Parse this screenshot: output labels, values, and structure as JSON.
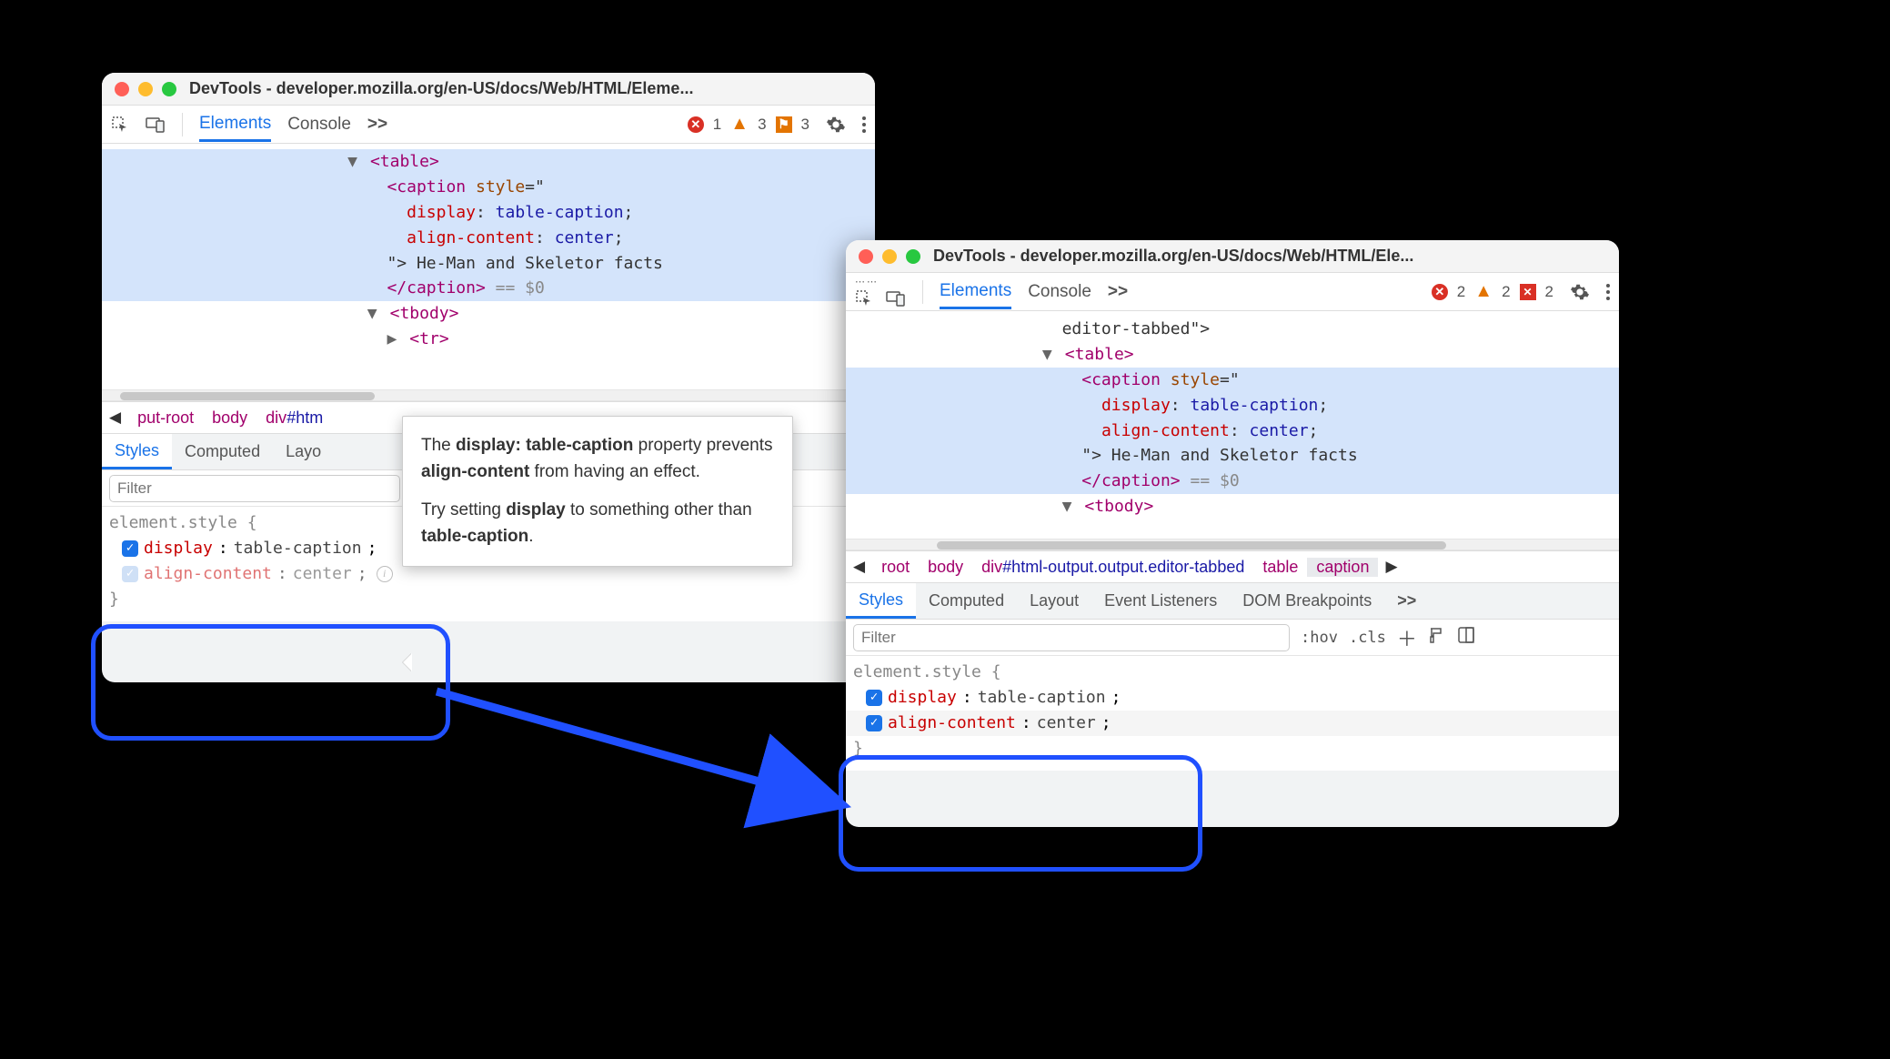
{
  "window1": {
    "title": "DevTools - developer.mozilla.org/en-US/docs/Web/HTML/Eleme...",
    "tabs": {
      "elements": "Elements",
      "console": "Console",
      "more": ">>"
    },
    "status": {
      "errors": "1",
      "warnings": "3",
      "flags": "3"
    },
    "dom": {
      "table_open": "<table>",
      "caption_open": "<caption",
      "style_attr": "style",
      "style_eq": "=\"",
      "css_display_prop": "display",
      "css_display_val": "table-caption",
      "css_align_prop": "align-content",
      "css_align_val": "center",
      "style_close": "\">",
      "caption_text": " He-Man and Skeletor facts",
      "caption_close": "</caption>",
      "eq_dollar": " == $0",
      "tbody_open": "<tbody>",
      "tr_open": "<tr>"
    },
    "breadcrumb": {
      "item0": "put-root",
      "item1": "body",
      "item2": "div",
      "item2_suffix": "#htm"
    },
    "subtabs": {
      "styles": "Styles",
      "computed": "Computed",
      "layout": "Layo"
    },
    "filter_placeholder": "Filter",
    "styles": {
      "selector": "element.style {",
      "p1_name": "display",
      "p1_value": "table-caption",
      "p2_name": "align-content",
      "p2_value": "center",
      "close": "}"
    }
  },
  "window2": {
    "title": "DevTools - developer.mozilla.org/en-US/docs/Web/HTML/Ele...",
    "tabs": {
      "elements": "Elements",
      "console": "Console",
      "more": ">>"
    },
    "status": {
      "errors": "2",
      "warnings": "2",
      "squares": "2"
    },
    "dom": {
      "prev_line": "editor-tabbed\">",
      "table_open": "<table>",
      "caption_open": "<caption",
      "style_attr": "style",
      "style_eq": "=\"",
      "css_display_prop": "display",
      "css_display_val": "table-caption",
      "css_align_prop": "align-content",
      "css_align_val": "center",
      "style_close": "\">",
      "caption_text": " He-Man and Skeletor facts",
      "caption_close": "</caption>",
      "eq_dollar": " == $0",
      "tbody_open": "<tbody>"
    },
    "breadcrumb": {
      "item0": "root",
      "item1": "body",
      "item2": "div",
      "item2_suffix": "#html-output.output.editor-tabbed",
      "item3": "table",
      "item4": "caption"
    },
    "subtabs": {
      "styles": "Styles",
      "computed": "Computed",
      "layout": "Layout",
      "evt": "Event Listeners",
      "dom": "DOM Breakpoints",
      "more": ">>"
    },
    "filter_placeholder": "Filter",
    "filterbar": {
      "hov": ":hov",
      "cls": ".cls"
    },
    "styles": {
      "selector": "element.style {",
      "p1_name": "display",
      "p1_value": "table-caption",
      "p2_name": "align-content",
      "p2_value": "center",
      "close": "}"
    }
  },
  "tooltip": {
    "l1a": "The ",
    "l1b": "display: table-caption",
    "l1c": " property prevents ",
    "l1d": "align-content",
    "l1e": " from having an effect.",
    "l2a": "Try setting ",
    "l2b": "display",
    "l2c": " to something other than ",
    "l2d": "table-caption",
    "l2e": "."
  }
}
